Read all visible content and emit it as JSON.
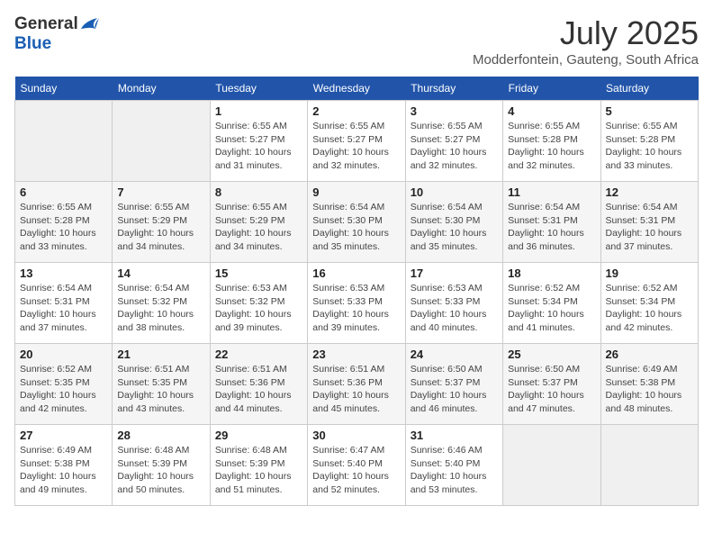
{
  "header": {
    "logo_general": "General",
    "logo_blue": "Blue",
    "month_title": "July 2025",
    "location": "Modderfontein, Gauteng, South Africa"
  },
  "weekdays": [
    "Sunday",
    "Monday",
    "Tuesday",
    "Wednesday",
    "Thursday",
    "Friday",
    "Saturday"
  ],
  "weeks": [
    [
      {
        "day": "",
        "info": ""
      },
      {
        "day": "",
        "info": ""
      },
      {
        "day": "1",
        "info": "Sunrise: 6:55 AM\nSunset: 5:27 PM\nDaylight: 10 hours\nand 31 minutes."
      },
      {
        "day": "2",
        "info": "Sunrise: 6:55 AM\nSunset: 5:27 PM\nDaylight: 10 hours\nand 32 minutes."
      },
      {
        "day": "3",
        "info": "Sunrise: 6:55 AM\nSunset: 5:27 PM\nDaylight: 10 hours\nand 32 minutes."
      },
      {
        "day": "4",
        "info": "Sunrise: 6:55 AM\nSunset: 5:28 PM\nDaylight: 10 hours\nand 32 minutes."
      },
      {
        "day": "5",
        "info": "Sunrise: 6:55 AM\nSunset: 5:28 PM\nDaylight: 10 hours\nand 33 minutes."
      }
    ],
    [
      {
        "day": "6",
        "info": "Sunrise: 6:55 AM\nSunset: 5:28 PM\nDaylight: 10 hours\nand 33 minutes."
      },
      {
        "day": "7",
        "info": "Sunrise: 6:55 AM\nSunset: 5:29 PM\nDaylight: 10 hours\nand 34 minutes."
      },
      {
        "day": "8",
        "info": "Sunrise: 6:55 AM\nSunset: 5:29 PM\nDaylight: 10 hours\nand 34 minutes."
      },
      {
        "day": "9",
        "info": "Sunrise: 6:54 AM\nSunset: 5:30 PM\nDaylight: 10 hours\nand 35 minutes."
      },
      {
        "day": "10",
        "info": "Sunrise: 6:54 AM\nSunset: 5:30 PM\nDaylight: 10 hours\nand 35 minutes."
      },
      {
        "day": "11",
        "info": "Sunrise: 6:54 AM\nSunset: 5:31 PM\nDaylight: 10 hours\nand 36 minutes."
      },
      {
        "day": "12",
        "info": "Sunrise: 6:54 AM\nSunset: 5:31 PM\nDaylight: 10 hours\nand 37 minutes."
      }
    ],
    [
      {
        "day": "13",
        "info": "Sunrise: 6:54 AM\nSunset: 5:31 PM\nDaylight: 10 hours\nand 37 minutes."
      },
      {
        "day": "14",
        "info": "Sunrise: 6:54 AM\nSunset: 5:32 PM\nDaylight: 10 hours\nand 38 minutes."
      },
      {
        "day": "15",
        "info": "Sunrise: 6:53 AM\nSunset: 5:32 PM\nDaylight: 10 hours\nand 39 minutes."
      },
      {
        "day": "16",
        "info": "Sunrise: 6:53 AM\nSunset: 5:33 PM\nDaylight: 10 hours\nand 39 minutes."
      },
      {
        "day": "17",
        "info": "Sunrise: 6:53 AM\nSunset: 5:33 PM\nDaylight: 10 hours\nand 40 minutes."
      },
      {
        "day": "18",
        "info": "Sunrise: 6:52 AM\nSunset: 5:34 PM\nDaylight: 10 hours\nand 41 minutes."
      },
      {
        "day": "19",
        "info": "Sunrise: 6:52 AM\nSunset: 5:34 PM\nDaylight: 10 hours\nand 42 minutes."
      }
    ],
    [
      {
        "day": "20",
        "info": "Sunrise: 6:52 AM\nSunset: 5:35 PM\nDaylight: 10 hours\nand 42 minutes."
      },
      {
        "day": "21",
        "info": "Sunrise: 6:51 AM\nSunset: 5:35 PM\nDaylight: 10 hours\nand 43 minutes."
      },
      {
        "day": "22",
        "info": "Sunrise: 6:51 AM\nSunset: 5:36 PM\nDaylight: 10 hours\nand 44 minutes."
      },
      {
        "day": "23",
        "info": "Sunrise: 6:51 AM\nSunset: 5:36 PM\nDaylight: 10 hours\nand 45 minutes."
      },
      {
        "day": "24",
        "info": "Sunrise: 6:50 AM\nSunset: 5:37 PM\nDaylight: 10 hours\nand 46 minutes."
      },
      {
        "day": "25",
        "info": "Sunrise: 6:50 AM\nSunset: 5:37 PM\nDaylight: 10 hours\nand 47 minutes."
      },
      {
        "day": "26",
        "info": "Sunrise: 6:49 AM\nSunset: 5:38 PM\nDaylight: 10 hours\nand 48 minutes."
      }
    ],
    [
      {
        "day": "27",
        "info": "Sunrise: 6:49 AM\nSunset: 5:38 PM\nDaylight: 10 hours\nand 49 minutes."
      },
      {
        "day": "28",
        "info": "Sunrise: 6:48 AM\nSunset: 5:39 PM\nDaylight: 10 hours\nand 50 minutes."
      },
      {
        "day": "29",
        "info": "Sunrise: 6:48 AM\nSunset: 5:39 PM\nDaylight: 10 hours\nand 51 minutes."
      },
      {
        "day": "30",
        "info": "Sunrise: 6:47 AM\nSunset: 5:40 PM\nDaylight: 10 hours\nand 52 minutes."
      },
      {
        "day": "31",
        "info": "Sunrise: 6:46 AM\nSunset: 5:40 PM\nDaylight: 10 hours\nand 53 minutes."
      },
      {
        "day": "",
        "info": ""
      },
      {
        "day": "",
        "info": ""
      }
    ]
  ]
}
